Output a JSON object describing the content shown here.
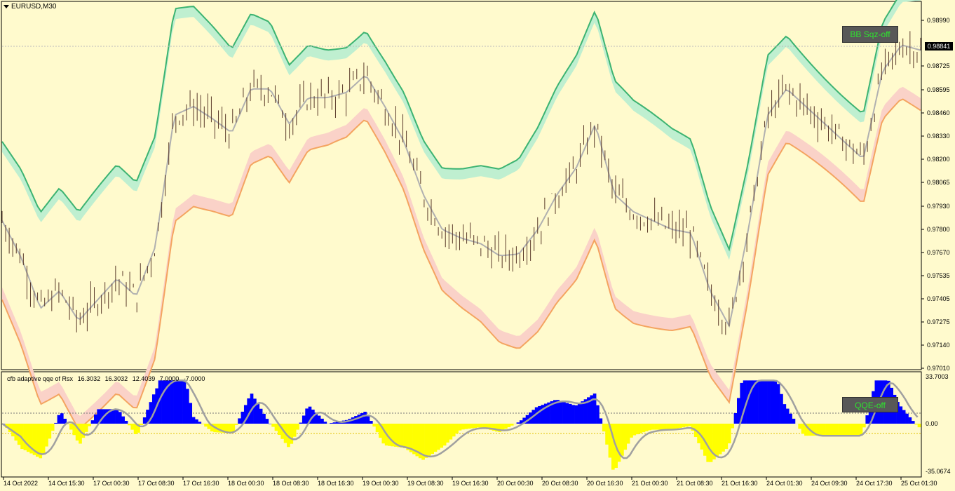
{
  "symbol_title": "EURUSD,M30",
  "indicator": {
    "name": "cfb adaptive qqe of Rsx",
    "values": [
      "16.3032",
      "16.3032",
      "12.4039",
      "7.0000",
      "-7.0000"
    ]
  },
  "buttons": {
    "bb_sqz": "BB Sqz-off",
    "qqe": "QQE-off"
  },
  "current_price": "0.98841",
  "price_axis": [
    "0.98990",
    "0.98725",
    "0.98595",
    "0.98460",
    "0.98330",
    "0.98200",
    "0.98065",
    "0.97930",
    "0.97800",
    "0.97670",
    "0.97535",
    "0.97405",
    "0.97275",
    "0.97140",
    "0.97010"
  ],
  "indicator_axis": [
    "33.7003",
    "0.00",
    "-35.0674"
  ],
  "time_axis": [
    "14 Oct 2022",
    "14 Oct 15:30",
    "17 Oct 00:30",
    "17 Oct 08:30",
    "17 Oct 16:30",
    "18 Oct 00:30",
    "18 Oct 08:30",
    "18 Oct 16:30",
    "19 Oct 00:30",
    "19 Oct 08:30",
    "19 Oct 16:30",
    "20 Oct 00:30",
    "20 Oct 08:30",
    "20 Oct 16:30",
    "21 Oct 00:30",
    "21 Oct 08:30",
    "21 Oct 16:30",
    "24 Oct 01:30",
    "24 Oct 09:30",
    "24 Oct 17:30",
    "25 Oct 01:30"
  ],
  "colors": {
    "background": "#FFFACD",
    "upper_band": "#3CB371",
    "upper_fill": "#BFEFD0",
    "lower_band": "#F4A460",
    "lower_fill": "#FAD2C8",
    "mid_line": "#B0B0B0",
    "hist_up": "#0000FF",
    "hist_down": "#FFFF00",
    "button_bg": "#585858",
    "button_text": "#2EE62E"
  },
  "icons": {
    "menu": "dropdown-triangle-icon"
  },
  "chart_data": {
    "type": "candlestick-with-indicators",
    "title": "EURUSD,M30",
    "ylim": [
      0.9701,
      0.9912
    ],
    "indicator_ylim": [
      -35.0674,
      33.7003
    ],
    "series": [
      {
        "name": "close",
        "values": [
          0.9785,
          0.9764,
          0.9735,
          0.9745,
          0.9728,
          0.974,
          0.9752,
          0.9742,
          0.977,
          0.9845,
          0.985,
          0.9843,
          0.9835,
          0.986,
          0.986,
          0.984,
          0.9855,
          0.9855,
          0.9858,
          0.9868,
          0.985,
          0.983,
          0.98,
          0.978,
          0.9775,
          0.9772,
          0.9765,
          0.9766,
          0.978,
          0.98,
          0.9815,
          0.984,
          0.98,
          0.979,
          0.9785,
          0.978,
          0.9778,
          0.9745,
          0.9725,
          0.978,
          0.9845,
          0.986,
          0.985,
          0.984,
          0.983,
          0.982,
          0.987,
          0.9885,
          0.9882
        ]
      }
    ]
  }
}
